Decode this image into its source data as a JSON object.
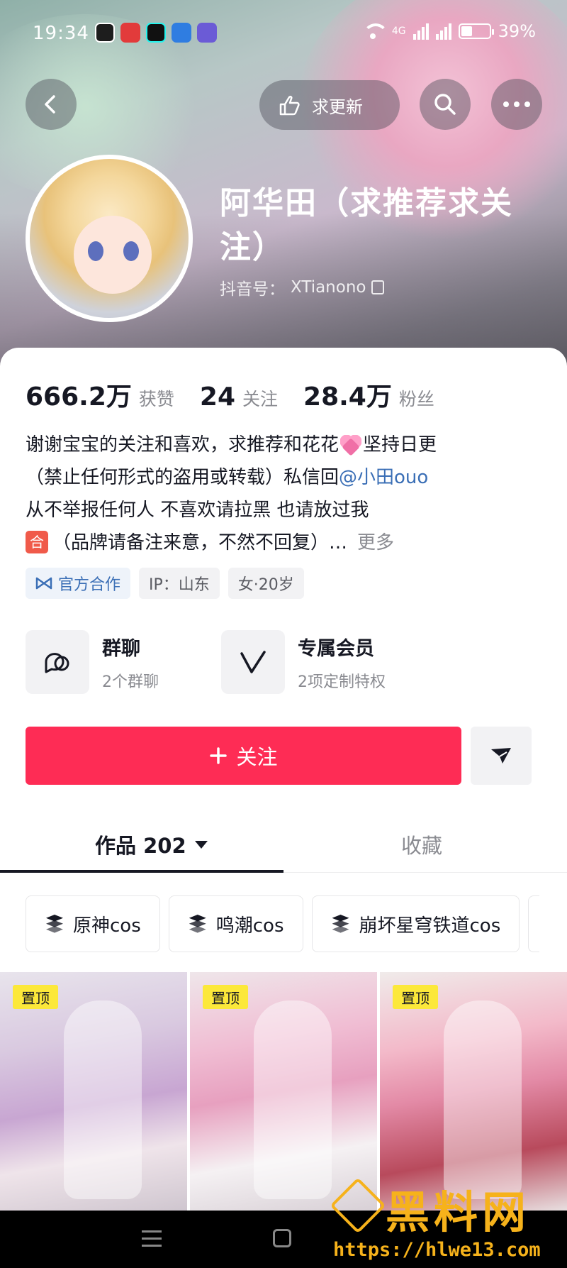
{
  "status_bar": {
    "time": "19:34",
    "network_label": "4G",
    "battery_text": "39%",
    "battery_level": 0.39,
    "app_icons": [
      "qq-icon",
      "app-icon",
      "douyin-icon",
      "browser-icon",
      "message-icon"
    ]
  },
  "header": {
    "back_icon": "chevron-left-icon",
    "request_update_label": "求更新",
    "request_update_icon": "hand-pointing-icon",
    "search_icon": "search-icon",
    "more_icon": "more-horizontal-icon"
  },
  "profile": {
    "name": "阿华田（求推荐求关注）",
    "douyin_id_label": "抖音号：",
    "douyin_id": "XTianono",
    "copy_icon": "copy-icon"
  },
  "stats": [
    {
      "value": "666.2万",
      "label": "获赞"
    },
    {
      "value": "24",
      "label": "关注"
    },
    {
      "value": "28.4万",
      "label": "粉丝"
    }
  ],
  "bio": {
    "line1_a": "谢谢宝宝的关注和喜欢，求推荐和花花",
    "line1_b": "坚持日更",
    "line2_a": "（禁止任何形式的盗用或转载）私信回",
    "mention": "@小田ouo",
    "line3": "从不举报任何人 不喜欢请拉黑 也请放过我",
    "badge": "合",
    "line4": "（品牌请备注来意，不然不回复）…",
    "more": "更多"
  },
  "tags": [
    {
      "label": "官方合作",
      "icon": "cooperation-icon"
    },
    {
      "label": "IP：山东"
    },
    {
      "label": "女·20岁"
    }
  ],
  "features": [
    {
      "title": "群聊",
      "sub": "2个群聊",
      "icon": "chat-bubbles-icon"
    },
    {
      "title": "专属会员",
      "sub": "2项定制特权",
      "icon": "member-v-icon"
    }
  ],
  "actions": {
    "follow_label": "关注",
    "follow_icon": "plus-icon",
    "share_icon": "share-arrow-icon"
  },
  "tabs": {
    "works_label": "作品 202",
    "favorites_label": "收藏"
  },
  "collections": [
    {
      "label": "原神cos"
    },
    {
      "label": "鸣潮cos"
    },
    {
      "label": "崩坏星穹铁道cos"
    }
  ],
  "videos": [
    {
      "pin_label": "置顶"
    },
    {
      "pin_label": "置顶"
    },
    {
      "pin_label": "置顶"
    }
  ],
  "watermark": {
    "title": "黑料网",
    "url": "https://hlwe13.com"
  },
  "colors": {
    "accent": "#fe2c55",
    "mention": "#3b6fb6",
    "pin_badge": "#fce83a",
    "watermark": "#f6b21b"
  }
}
